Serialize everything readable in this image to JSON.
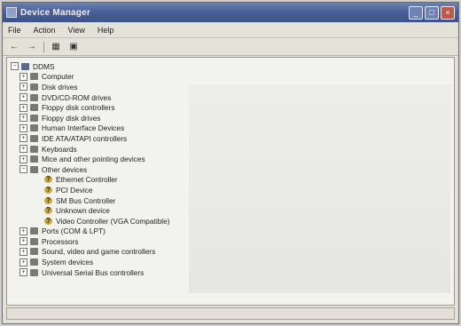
{
  "window": {
    "title": "Device Manager"
  },
  "menu": [
    "File",
    "Action",
    "View",
    "Help"
  ],
  "toolbar": {
    "back_icon": "back-arrow-icon",
    "forward_icon": "forward-arrow-icon",
    "properties_icon": "properties-icon",
    "help_icon": "help-icon"
  },
  "tree": {
    "root": "DDMS",
    "categories": [
      {
        "label": "Computer",
        "icon": "computer-icon"
      },
      {
        "label": "Disk drives",
        "icon": "disk-drive-icon"
      },
      {
        "label": "DVD/CD-ROM drives",
        "icon": "dvd-drive-icon"
      },
      {
        "label": "Floppy disk controllers",
        "icon": "floppy-controller-icon"
      },
      {
        "label": "Floppy disk drives",
        "icon": "floppy-drive-icon"
      },
      {
        "label": "Human Interface Devices",
        "icon": "hid-icon"
      },
      {
        "label": "IDE ATA/ATAPI controllers",
        "icon": "ide-controller-icon"
      },
      {
        "label": "Keyboards",
        "icon": "keyboard-icon"
      },
      {
        "label": "Mice and other pointing devices",
        "icon": "mouse-icon"
      },
      {
        "label": "Other devices",
        "icon": "other-devices-icon"
      }
    ],
    "other_devices": [
      "Ethernet Controller",
      "PCI Device",
      "SM Bus Controller",
      "Unknown device",
      "Video Controller (VGA Compatible)"
    ],
    "categories_after": [
      {
        "label": "Ports (COM & LPT)",
        "icon": "ports-icon"
      },
      {
        "label": "Processors",
        "icon": "processor-icon"
      },
      {
        "label": "Sound, video and game controllers",
        "icon": "sound-icon"
      },
      {
        "label": "System devices",
        "icon": "system-devices-icon"
      },
      {
        "label": "Universal Serial Bus controllers",
        "icon": "usb-icon"
      }
    ]
  }
}
